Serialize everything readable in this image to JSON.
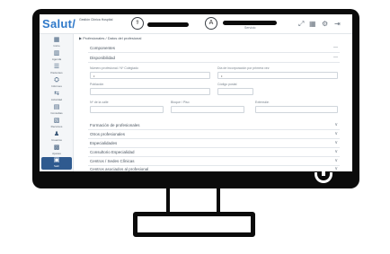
{
  "app": {
    "logo": "Salut/",
    "logo_sub": "Gestión Clínica Hospital",
    "header_icon_1": "user-md",
    "header_icon_2": "A",
    "header_small": "Servicio",
    "breadcrumb": "▶ Profesionales / Datos del profesional"
  },
  "sidebar": {
    "items": [
      {
        "label": "Inicio",
        "icon": "▦"
      },
      {
        "label": "Agenda",
        "icon": "▥"
      },
      {
        "label": "Pacientes",
        "icon": "☰"
      },
      {
        "label": "Informes",
        "icon": "⛭"
      },
      {
        "label": "Actividad",
        "icon": "⇆"
      },
      {
        "label": "Consultas",
        "icon": "▤"
      },
      {
        "label": "Recursos",
        "icon": "▧"
      },
      {
        "label": "Usuarios",
        "icon": "♟"
      },
      {
        "label": "Ajustes",
        "icon": "▩"
      },
      {
        "label": "Salir",
        "icon": "▣"
      }
    ]
  },
  "sections": {
    "top": [
      {
        "title": "Componentes",
        "chevron": "—"
      },
      {
        "title": "Disponibilidad",
        "chevron": "—"
      }
    ],
    "fields_row1": [
      {
        "label": "Número profesional / Nº Colegiado",
        "value": "•"
      },
      {
        "label": "Día de incorporación por primera vez",
        "value": "•"
      }
    ],
    "fields_row2": [
      {
        "label": "Población",
        "value": ""
      },
      {
        "label": "Código postal",
        "value": ""
      }
    ],
    "fields_row3": [
      {
        "label": "Nº de la calle",
        "value": ""
      },
      {
        "label": "Bloque / Piso",
        "value": ""
      },
      {
        "label": "Extensión",
        "value": ""
      }
    ],
    "bottom": [
      {
        "title": "Formación de profesionales",
        "chevron": "∨"
      },
      {
        "title": "Otros profesionales",
        "chevron": "∨"
      },
      {
        "title": "Especialidades",
        "chevron": "∨"
      },
      {
        "title": "Consultorio Especialidad",
        "chevron": "∨"
      },
      {
        "title": "Centros / Sedes Clínicas",
        "chevron": "∨"
      },
      {
        "title": "Centros asociados al profesional",
        "chevron": "∨"
      }
    ]
  }
}
